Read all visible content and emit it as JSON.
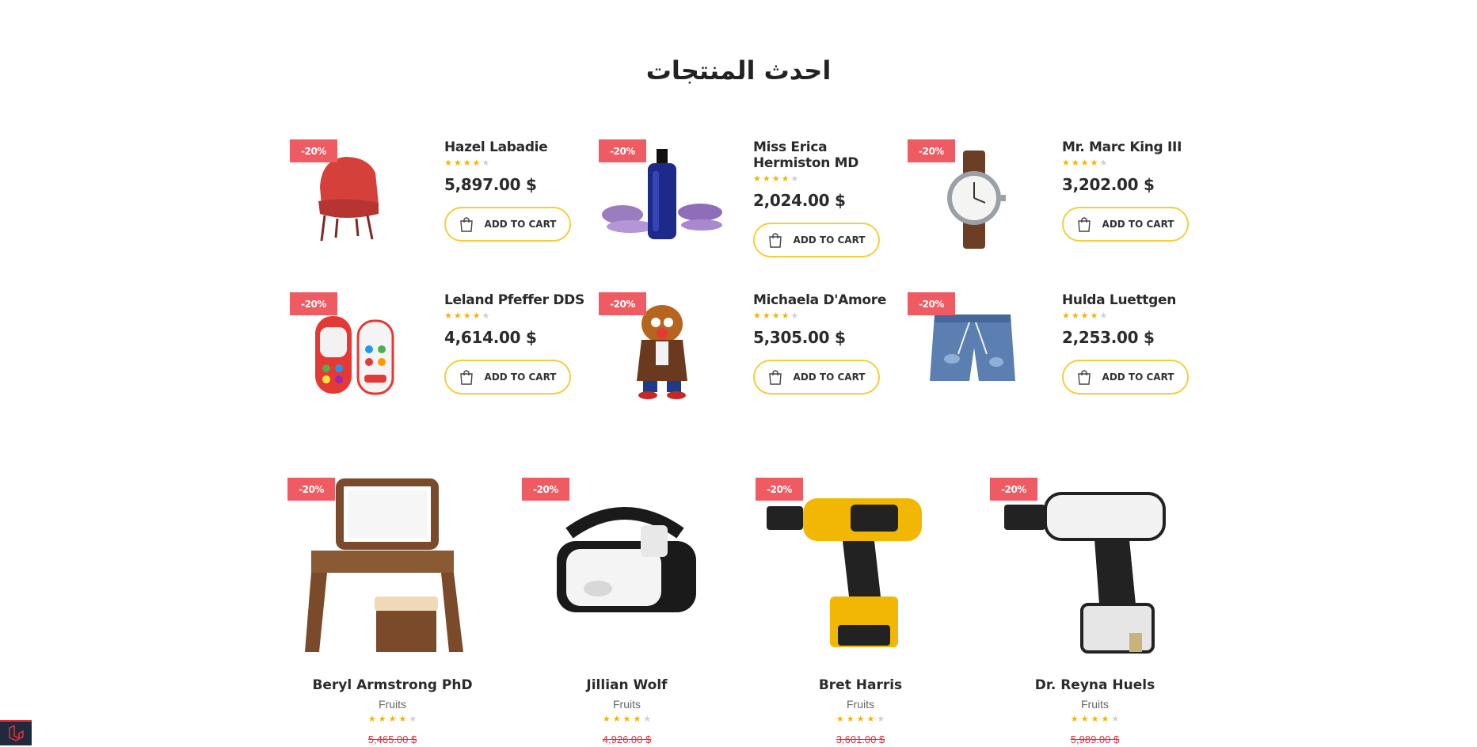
{
  "section": {
    "title": "احدث المنتجات"
  },
  "mini_products": [
    {
      "badge": "-20%",
      "name": "Hazel Labadie",
      "rating": 4,
      "price": "5,897.00 $",
      "cart_label": "ADD TO CART",
      "image": "red-armchair"
    },
    {
      "badge": "-20%",
      "name": "Miss Erica Hermiston MD",
      "rating": 4,
      "price": "2,024.00 $",
      "cart_label": "ADD TO CART",
      "image": "lavender-bottle"
    },
    {
      "badge": "-20%",
      "name": "Mr. Marc King III",
      "rating": 4,
      "price": "3,202.00 $",
      "cart_label": "ADD TO CART",
      "image": "wrist-watch"
    },
    {
      "badge": "-20%",
      "name": "Leland Pfeffer DDS",
      "rating": 4,
      "price": "4,614.00 $",
      "cart_label": "ADD TO CART",
      "image": "toy-phones"
    },
    {
      "badge": "-20%",
      "name": "Michaela D'Amore",
      "rating": 4,
      "price": "5,305.00 $",
      "cart_label": "ADD TO CART",
      "image": "potato-toy"
    },
    {
      "badge": "-20%",
      "name": "Hulda Luettgen",
      "rating": 4,
      "price": "2,253.00 $",
      "cart_label": "ADD TO CART",
      "image": "denim-shorts"
    }
  ],
  "featured_products": [
    {
      "badge": "-20%",
      "name": "Beryl Armstrong PhD",
      "category": "Fruits",
      "rating": 4,
      "old_price": "5,465.00 $",
      "image": "vanity-table"
    },
    {
      "badge": "-20%",
      "name": "Jillian Wolf",
      "category": "Fruits",
      "rating": 4,
      "old_price": "4,926.00 $",
      "image": "vr-headset"
    },
    {
      "badge": "-20%",
      "name": "Bret Harris",
      "category": "Fruits",
      "rating": 4,
      "old_price": "3,601.00 $",
      "image": "yellow-drill"
    },
    {
      "badge": "-20%",
      "name": "Dr. Reyna Huels",
      "category": "Fruits",
      "rating": 4,
      "old_price": "5,989.00 $",
      "image": "white-drill"
    }
  ],
  "colors": {
    "badge": "#ef5b63",
    "star": "#f5b301",
    "cart_border": "#f4cd3c",
    "old_price": "#e12e3c"
  },
  "icons": {
    "cart": "shopping-bag-icon",
    "corner_logo": "laravel-logo-icon"
  }
}
